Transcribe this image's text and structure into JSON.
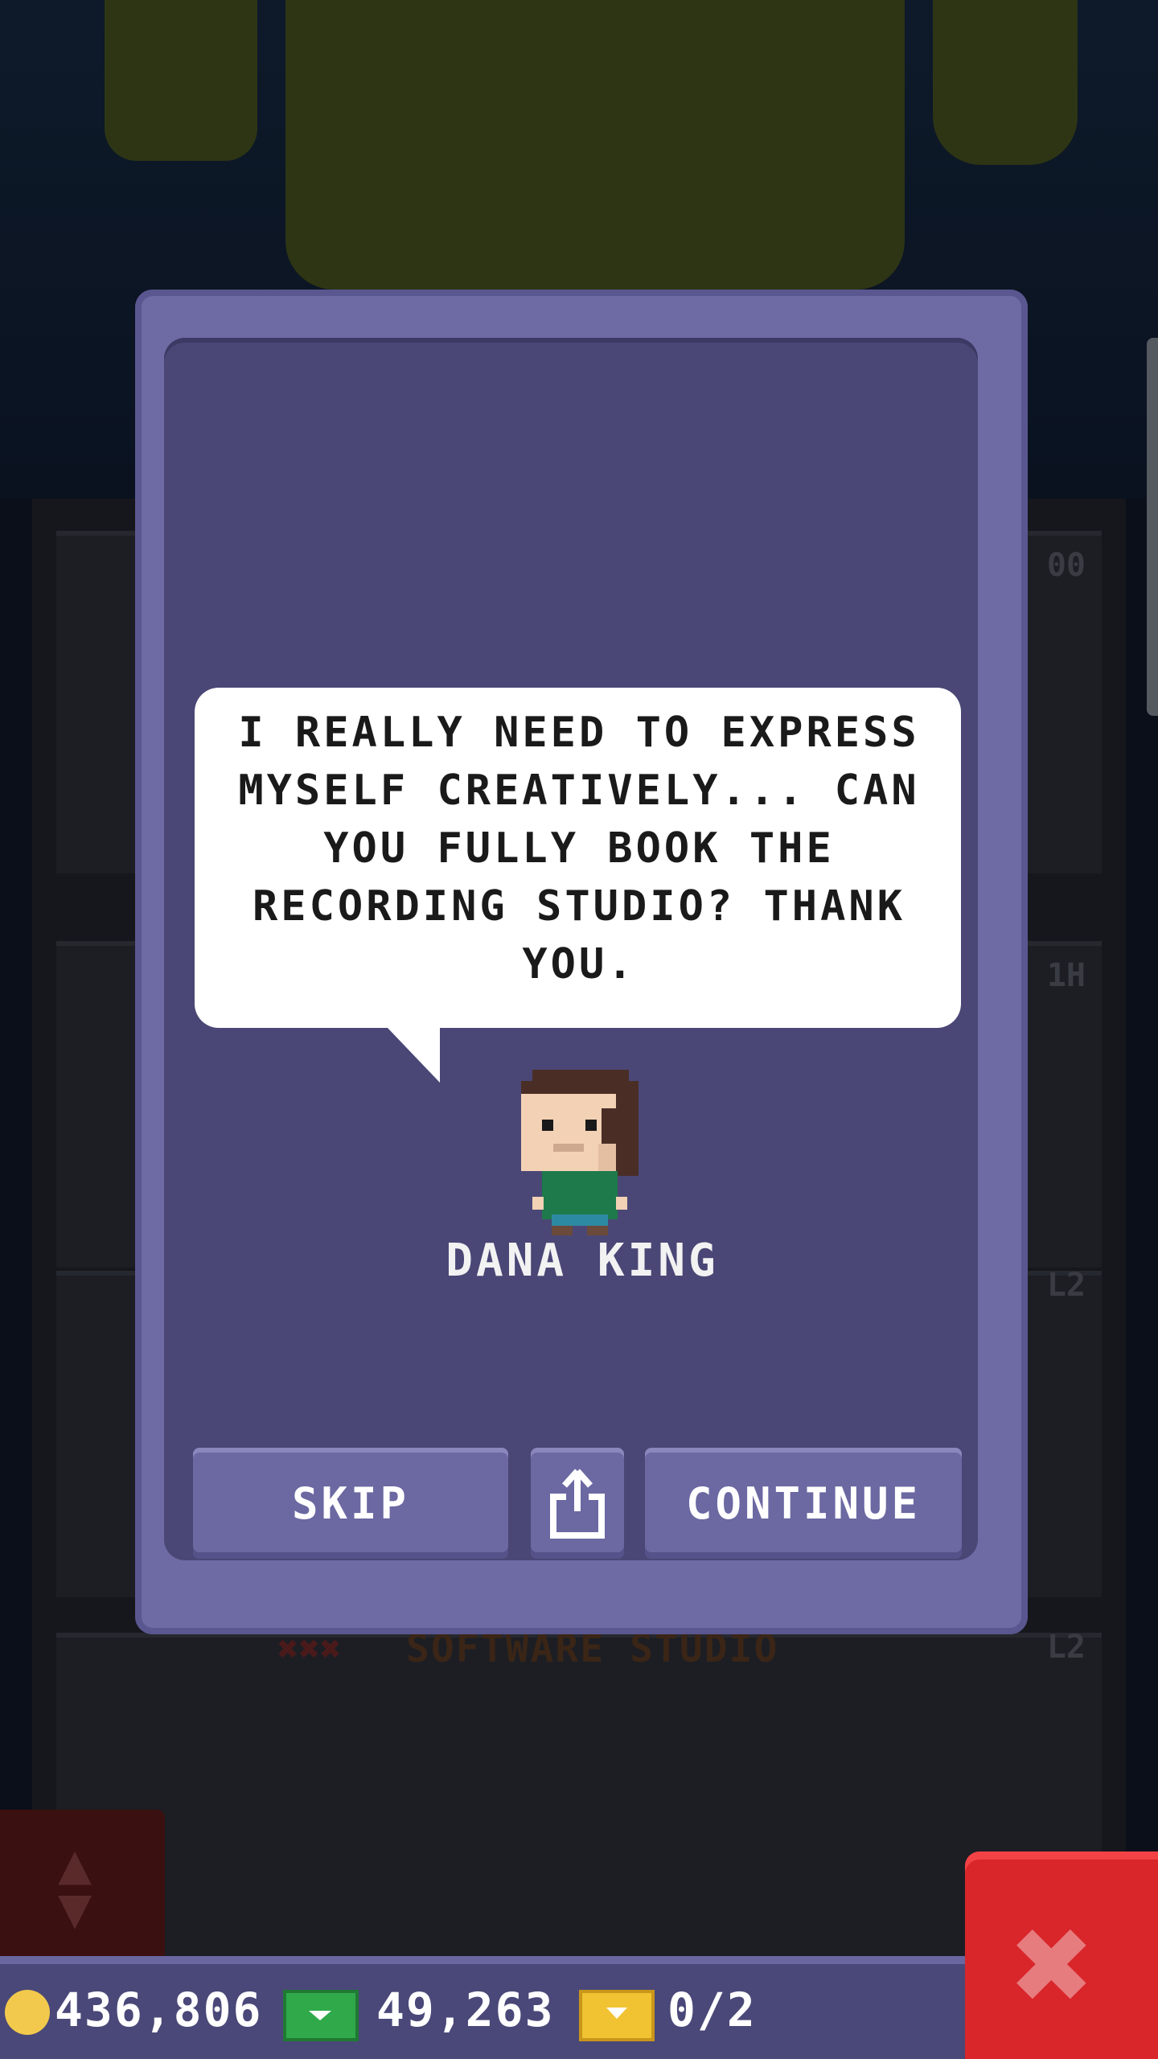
{
  "background": {
    "floor_name": "SOFTWARE STUDIO",
    "floor_levels": [
      "00",
      "1H",
      "L2",
      "L2"
    ]
  },
  "dialog": {
    "quote": "I REALLY NEED TO EXPRESS MYSELF CREATIVELY... CAN YOU FULLY BOOK THE RECORDING STUDIO? THANK YOU.",
    "character_name": "DANA KING",
    "buttons": {
      "skip": "SKIP",
      "share_icon": "share-icon",
      "continue": "CONTINUE"
    }
  },
  "resources": {
    "coins": "436,806",
    "coins_icon": "coin-icon",
    "cash": "49,263",
    "cash_icon": "cash-icon",
    "bux": "0/2",
    "bux_icon": "bux-ticket-icon"
  },
  "close_icon": "close-icon",
  "colors": {
    "card_frame": "#6e6aa4",
    "card_inner": "#4a4776",
    "close_button": "#d8262b"
  }
}
